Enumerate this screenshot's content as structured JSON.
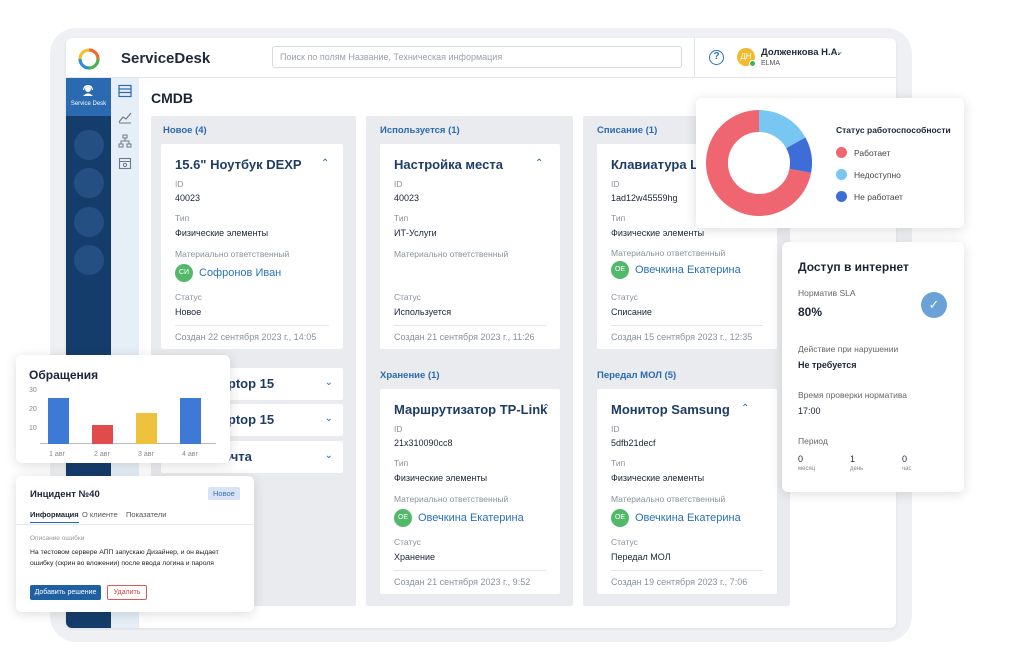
{
  "app": {
    "brand": "ServiceDesk",
    "search_placeholder": "Поиск по полям Название, Техническая информация",
    "help_icon": "?",
    "user": {
      "initials": "ДН",
      "name": "Долженкова Н.А.",
      "org": "ELMA"
    },
    "nav_label": "Service Desk",
    "page_title": "CMDB"
  },
  "colors": {
    "nav": "#153d6b",
    "accent": "#2a6ab0",
    "ok": "#f06670",
    "unavailable": "#78c6f2",
    "down": "#3e6dd8"
  },
  "columns": [
    {
      "title": "Новое (4)",
      "card": {
        "title": "15.6\" Ноутбук DEXP",
        "id_label": "ID",
        "id": "40023",
        "type_label": "Тип",
        "type": "Физические элементы",
        "owner_label": "Материально ответственный",
        "owner_initials": "СИ",
        "owner": "Софронов Иван",
        "status_label": "Статус",
        "status": "Новое",
        "created": "Создан 22 сентября 2023 г., 14:05"
      },
      "collapsed": [
        "ASUS Laptop 15",
        "ASUS Laptop 15",
        "ивная почта"
      ]
    },
    {
      "title": "Используется (1)",
      "card": {
        "title": "Настройка места",
        "id_label": "ID",
        "id": "40023",
        "type_label": "Тип",
        "type": "ИТ-Услуги",
        "owner_label": "Материально ответственный",
        "status_label": "Статус",
        "status": "Используется",
        "created": "Создан 21 сентября 2023 г., 11:26"
      },
      "title2": "Хранение (1)",
      "card2": {
        "title": "Маршрутизатор TP-Link",
        "id_label": "ID",
        "id": "21x310090cc8",
        "type_label": "Тип",
        "type": "Физические элементы",
        "owner_label": "Материально ответственный",
        "owner_initials": "ОЕ",
        "owner": "Овечкина Екатерина",
        "status_label": "Статус",
        "status": "Хранение",
        "created": "Создан 21 сентября 2023 г., 9:52"
      }
    },
    {
      "title": "Списание (1)",
      "card": {
        "title": "Клавиатура Lo",
        "id_label": "ID",
        "id": "1ad12w45559hg",
        "type_label": "Тип",
        "type": "Физические элементы",
        "owner_label": "Материально ответственный",
        "owner_initials": "ОЕ",
        "owner": "Овечкина Екатерина",
        "status_label": "Статус",
        "status": "Списание",
        "created": "Создан 15 сентября 2023 г., 12:35"
      },
      "title2": "Передал МОЛ (5)",
      "card2": {
        "title": "Монитор Samsung",
        "id_label": "ID",
        "id": "5dfb21decf",
        "type_label": "Тип",
        "type": "Физические элементы",
        "owner_label": "Материально ответственный",
        "owner_initials": "ОЕ",
        "owner": "Овечкина Екатерина",
        "status_label": "Статус",
        "status": "Передал МОЛ",
        "created": "Создан 19 сентября 2023 г., 7:06"
      }
    }
  ],
  "donut": {
    "title": "Статус работоспособности",
    "segments": [
      {
        "label": "Работает",
        "value": 72,
        "color": "#f06670"
      },
      {
        "label": "Недоступно",
        "value": 17,
        "color": "#78c6f2"
      },
      {
        "label": "Не работает",
        "value": 11,
        "color": "#3e6dd8"
      }
    ]
  },
  "sla": {
    "title": "Доступ в интернет",
    "norm_label": "Норматив SLA",
    "norm": "80%",
    "action_label": "Действие при нарушении",
    "action": "Не требуется",
    "check_label": "Время проверки норматива",
    "check": "17:00",
    "period_label": "Период",
    "period": [
      {
        "value": "0",
        "unit": "месяц"
      },
      {
        "value": "1",
        "unit": "день"
      },
      {
        "value": "0",
        "unit": "час"
      }
    ]
  },
  "chart_data": {
    "type": "bar",
    "title": "Обращения",
    "categories": [
      "1 авг",
      "2 авг",
      "3 авг",
      "4 авг"
    ],
    "values": [
      31,
      13,
      21,
      31
    ],
    "ylim": [
      0,
      30
    ],
    "yticks": [
      "30",
      "20",
      "10"
    ],
    "colors": [
      "#3f79d6",
      "#e24b4b",
      "#efc23e",
      "#3f79d6"
    ]
  },
  "incident": {
    "title": "Инцидент №40",
    "badge": "Новое",
    "tabs": [
      "Информация",
      "О клиенте",
      "Показатели"
    ],
    "desc_label": "Описание ошибки",
    "desc": "На тестовом сервере АПП запускаю Дизайнер, и он выдает ошибку (скрин во вложении) после ввода логина и пароля",
    "primary": "Добавить решение",
    "secondary": "Удалить"
  }
}
